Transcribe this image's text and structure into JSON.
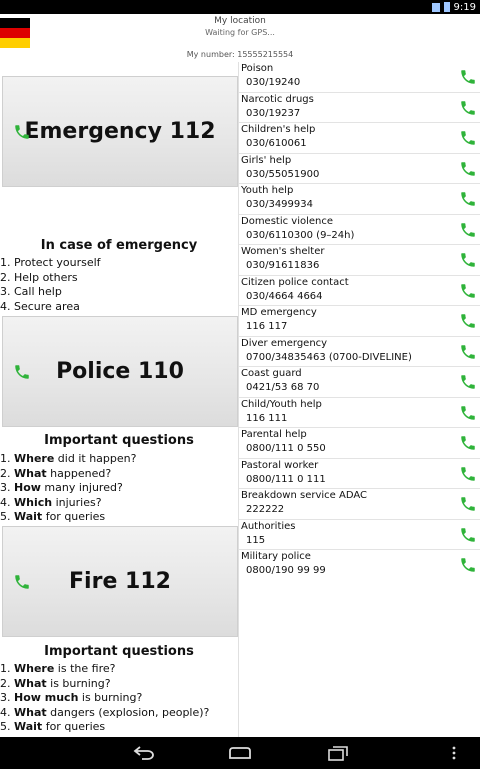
{
  "status_bar": {
    "time": "9:19"
  },
  "header": {
    "title": "My location",
    "subtitle": "Waiting for GPS...",
    "number_label": "My number: 15555215554"
  },
  "emergency_button": {
    "label": "Emergency 112"
  },
  "emergency_section": {
    "title": "In case of emergency",
    "items": [
      "1. Protect yourself",
      "2. Help others",
      "3. Call help",
      "4. Secure area"
    ]
  },
  "police_button": {
    "label": "Police 110"
  },
  "police_section": {
    "title": "Important questions",
    "items": [
      {
        "prefix": "1. ",
        "bold": "Where",
        "rest": " did it happen?"
      },
      {
        "prefix": "2. ",
        "bold": "What",
        "rest": " happened?"
      },
      {
        "prefix": "3. ",
        "bold": "How",
        "rest": " many injured?"
      },
      {
        "prefix": "4. ",
        "bold": "Which",
        "rest": " injuries?"
      },
      {
        "prefix": "5. ",
        "bold": "Wait",
        "rest": " for queries"
      }
    ]
  },
  "fire_button": {
    "label": "Fire 112"
  },
  "fire_section": {
    "title": "Important questions",
    "items": [
      {
        "prefix": "1. ",
        "bold": "Where",
        "rest": " is the fire?"
      },
      {
        "prefix": "2. ",
        "bold": "What",
        "rest": " is burning?"
      },
      {
        "prefix": "3. ",
        "bold": "How much",
        "rest": " is burning?"
      },
      {
        "prefix": "4. ",
        "bold": "What",
        "rest": " dangers (explosion, people)?"
      },
      {
        "prefix": "5. ",
        "bold": "Wait",
        "rest": " for queries"
      }
    ]
  },
  "contacts": [
    {
      "name": "Poison",
      "number": "030/19240"
    },
    {
      "name": "Narcotic drugs",
      "number": "030/19237"
    },
    {
      "name": "Children's help",
      "number": "030/610061"
    },
    {
      "name": "Girls' help",
      "number": "030/55051900"
    },
    {
      "name": "Youth help",
      "number": "030/3499934"
    },
    {
      "name": "Domestic violence",
      "number": "030/6110300 (9–24h)"
    },
    {
      "name": "Women's shelter",
      "number": "030/91611836"
    },
    {
      "name": "Citizen police contact",
      "number": "030/4664 4664"
    },
    {
      "name": "MD emergency",
      "number": "116 117"
    },
    {
      "name": "Diver emergency",
      "number": "0700/34835463 (0700-DIVELINE)"
    },
    {
      "name": "Coast guard",
      "number": "0421/53 68 70"
    },
    {
      "name": "Child/Youth help",
      "number": "116 111"
    },
    {
      "name": "Parental help",
      "number": "0800/111 0 550"
    },
    {
      "name": "Pastoral worker",
      "number": "0800/111 0 111"
    },
    {
      "name": "Breakdown service ADAC",
      "number": "222222"
    },
    {
      "name": "Authorities",
      "number": "115"
    },
    {
      "name": "Military police",
      "number": "0800/190 99 99"
    }
  ],
  "colors": {
    "phone_green": "#2fb33a",
    "flag_black": "#000000",
    "flag_red": "#dd0000",
    "flag_gold": "#ffce00"
  }
}
